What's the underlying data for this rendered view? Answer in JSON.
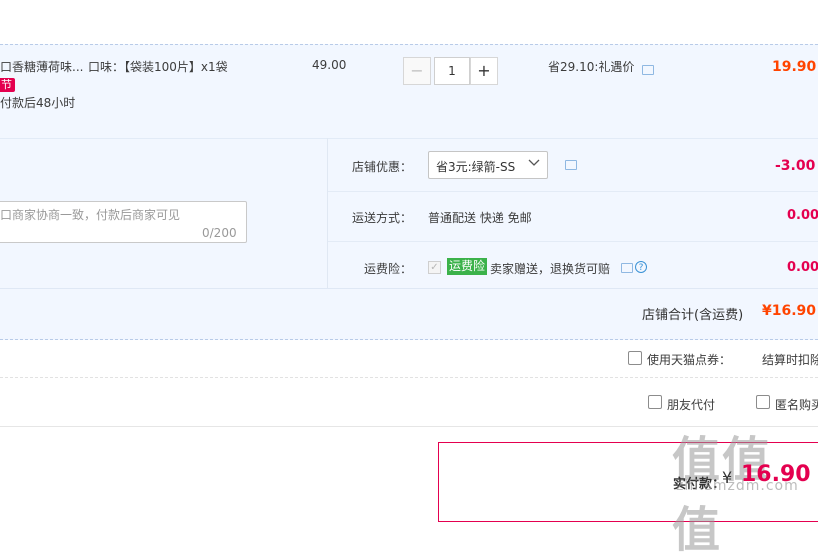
{
  "item": {
    "title": "口香糖薄荷味...",
    "attr": "口味：【袋装100片】x1袋",
    "promo_tag": "节",
    "ship_note": "付款后48小时",
    "unit_price": "49.00",
    "quantity": "1",
    "qty_minus": "−",
    "qty_plus": "+",
    "saving": "省29.10:礼遇价",
    "subtotal": "19.90"
  },
  "options": {
    "note_placeholder": "口商家协商一致，付款后商家可见",
    "note_count": "0/200",
    "coupon_label": "店铺优惠：",
    "coupon_value": "省3元:绿箭-SS",
    "coupon_amount": "-3.00",
    "shipping_label": "运送方式：",
    "shipping_value": "普通配送 快递 免邮",
    "shipping_amount": "0.00",
    "insurance_label": "运费险：",
    "insurance_badge": "运费险",
    "insurance_text": "卖家赠送，退换货可赔",
    "insurance_amount": "0.00"
  },
  "shop_total": {
    "label": "店铺合计(含运费)",
    "value": "¥16.90"
  },
  "points": {
    "label": "使用天猫点券：",
    "note": "结算时扣除"
  },
  "extras": {
    "friend_pay": "朋友代付",
    "anonymous": "匿名购买"
  },
  "payment": {
    "label": "实付款：",
    "currency": "¥",
    "value": "16.90"
  },
  "watermark": {
    "main": "值值值",
    "sub": "zhi.smzdm.com"
  },
  "icons": {
    "comment": "comment-icon",
    "question": "question-icon",
    "chevron": "chevron-down-icon",
    "check": "checkbox-icon"
  },
  "colors": {
    "accent_red": "#e4004f",
    "price_orange": "#ff4400",
    "panel_bg": "#f2f7ff",
    "badge_green": "#3bb24a"
  }
}
